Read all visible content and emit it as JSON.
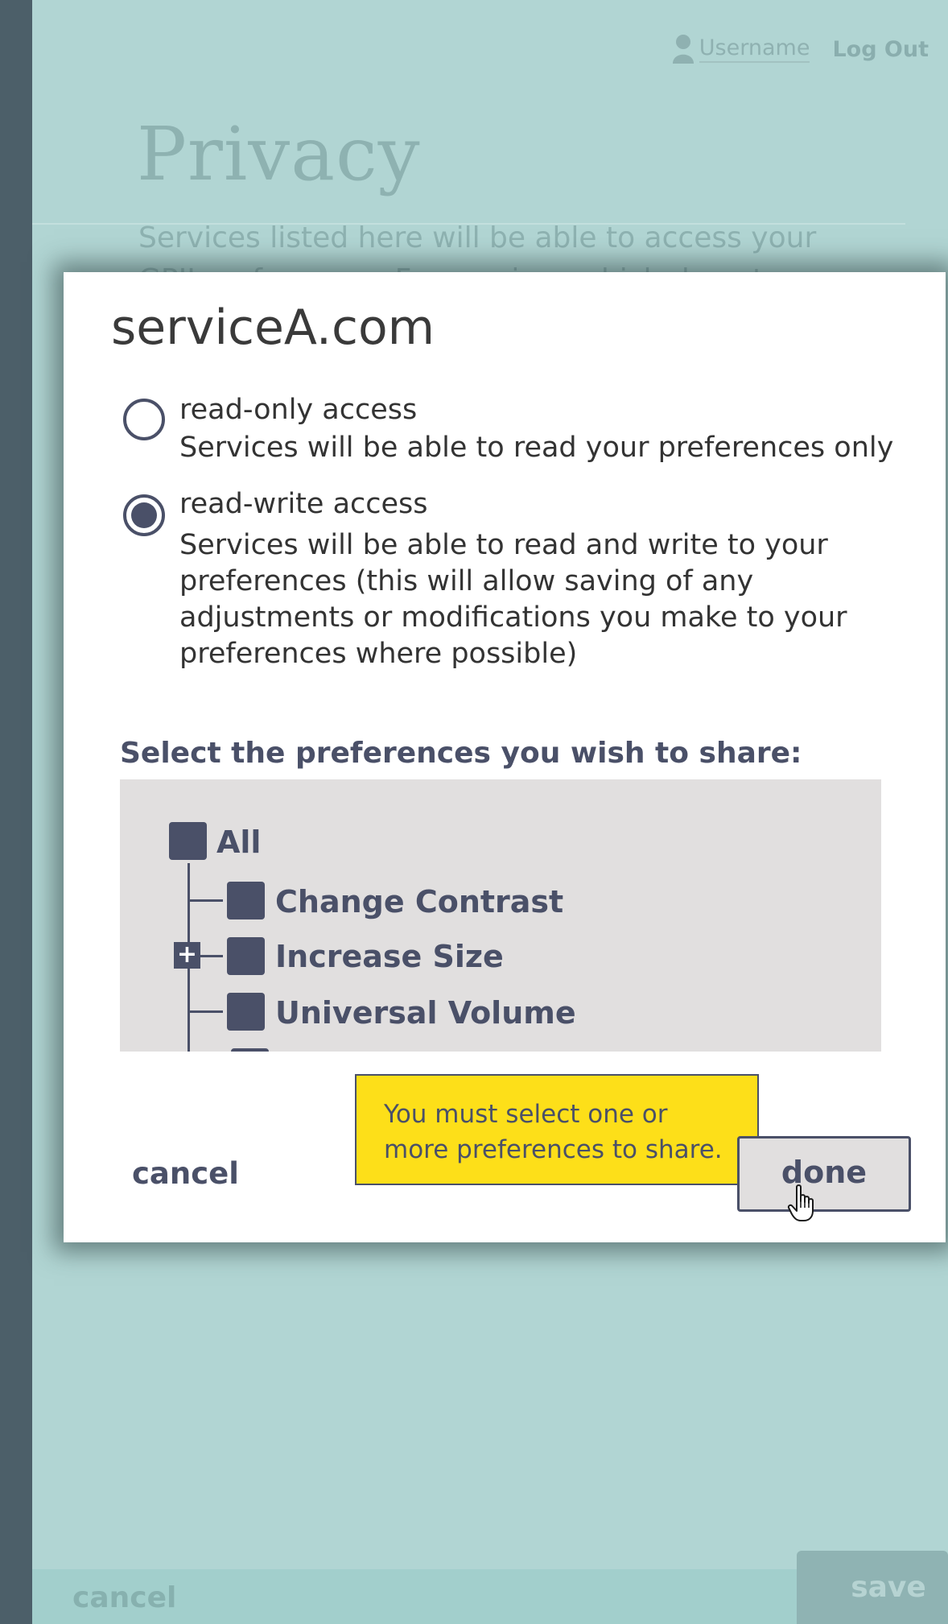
{
  "header": {
    "username": "Username",
    "logout_label": "Log Out"
  },
  "page": {
    "title": "Privacy",
    "intro": "Services listed here will be able to access your GPII preferences. For services which do not..."
  },
  "footer": {
    "cancel_label": "cancel",
    "save_label": "save"
  },
  "modal": {
    "title": "serviceA.com",
    "options": [
      {
        "label": "read-only access",
        "description": "Services will be able to read your preferences only",
        "selected": false
      },
      {
        "label": "read-write access",
        "description": "Services will be able to read and write to your preferences (this will allow saving of any adjustments or modifications you make to your preferences where possible)",
        "selected": true
      }
    ],
    "share_heading": "Select the preferences you wish to share:",
    "tree": {
      "root_label": "All",
      "items": [
        {
          "label": "Change Contrast",
          "expandable": false
        },
        {
          "label": "Increase Size",
          "expandable": true,
          "expander_symbol": "+"
        },
        {
          "label": "Universal Volume",
          "expandable": false
        }
      ]
    },
    "tooltip": "You must select one or more preferences to share.",
    "cancel_label": "cancel",
    "done_label": "done"
  },
  "colors": {
    "background": "#b1d5d3",
    "accent": "#4a5068",
    "tooltip": "#fddf19",
    "left_strip": "#4c5f69"
  }
}
